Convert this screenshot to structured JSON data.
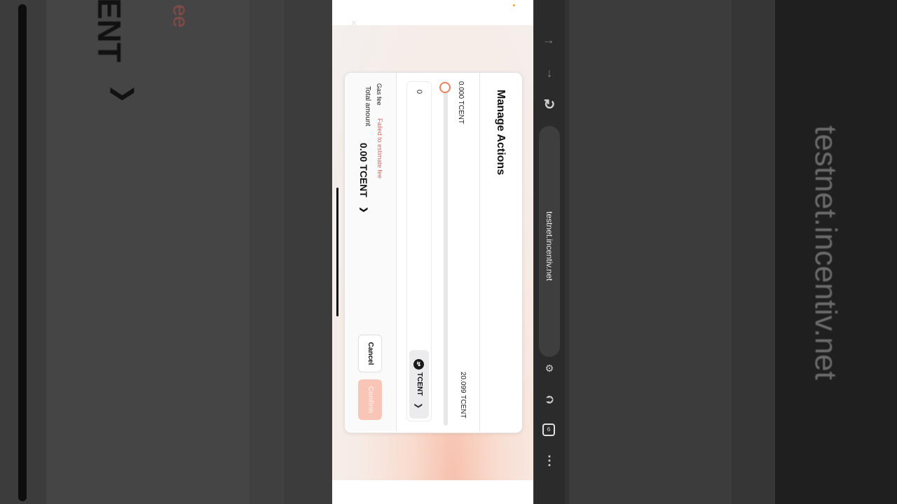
{
  "modal": {
    "title": "Manage Actions",
    "slider_min_label": "0.000 TCENT",
    "slider_max_label": "20.099 TCENT",
    "slider_fraction": 0.0,
    "amount_value": "0",
    "token_symbol": "TCENT",
    "gas_fee_label": "Gas fee",
    "gas_fee_error": "Failed to estimate fee",
    "total_label": "Total amount",
    "total_value": "0.00 TCENT",
    "cancel_label": "Cancel",
    "confirm_label": "Confirm"
  },
  "browser": {
    "url": "testnet.incentiv.net",
    "tab_count": "6"
  },
  "background": {
    "left_text": "ENT",
    "left_red_text": "ee",
    "right_text": "testnet.incentiv.net"
  },
  "colors": {
    "accent": "#e8835c",
    "error": "#e0655a",
    "confirm_disabled": "#f8c5b6"
  }
}
